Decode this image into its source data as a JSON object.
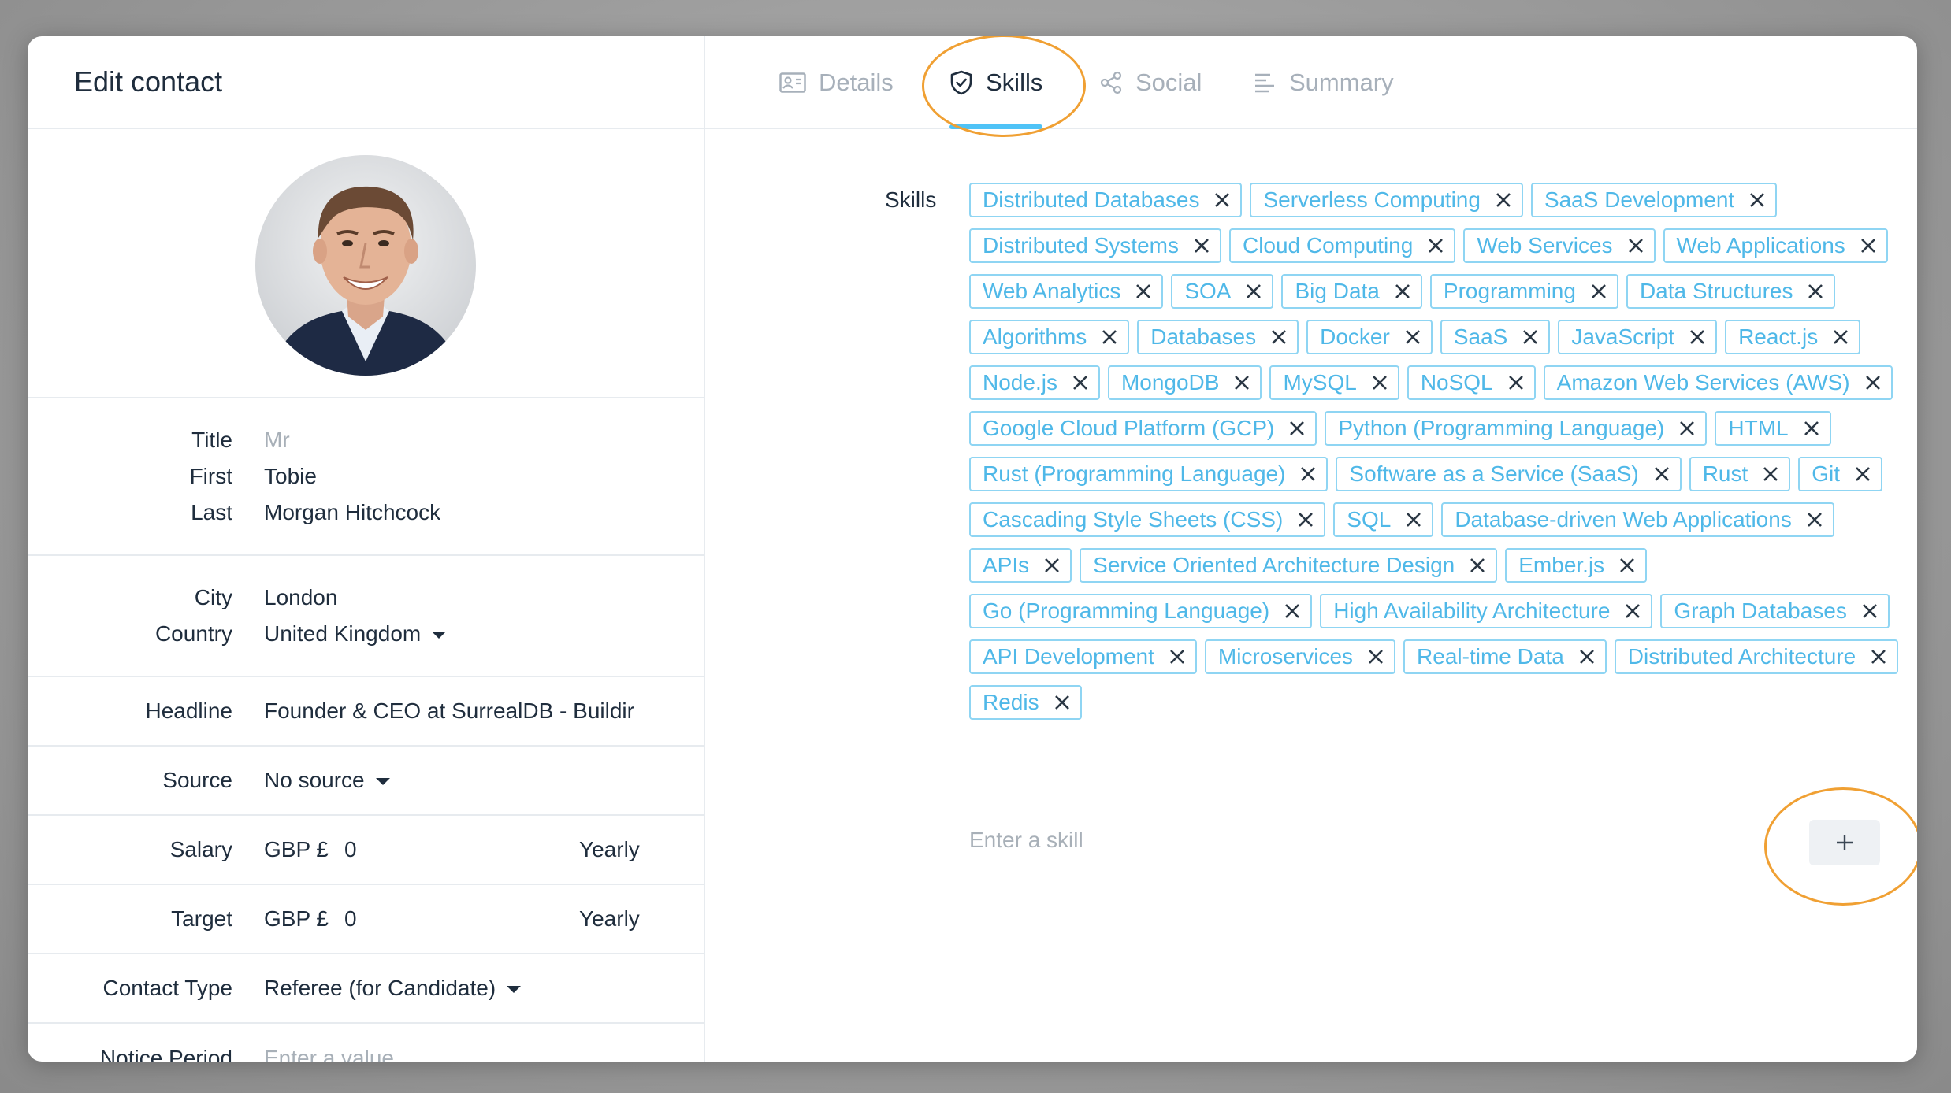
{
  "panel": {
    "title": "Edit contact"
  },
  "profile": {
    "title_label": "Title",
    "title_value": "Mr",
    "first_label": "First",
    "first_value": "Tobie",
    "last_label": "Last",
    "last_value": "Morgan Hitchcock",
    "city_label": "City",
    "city_value": "London",
    "country_label": "Country",
    "country_value": "United Kingdom",
    "headline_label": "Headline",
    "headline_value": "Founder & CEO at SurrealDB - Buildir",
    "source_label": "Source",
    "source_value": "No source",
    "salary_label": "Salary",
    "salary_currency": "GBP £",
    "salary_value": "0",
    "salary_period": "Yearly",
    "target_label": "Target",
    "target_currency": "GBP £",
    "target_value": "0",
    "target_period": "Yearly",
    "contact_type_label": "Contact Type",
    "contact_type_value": "Referee (for Candidate)",
    "notice_label": "Notice Period",
    "notice_placeholder": "Enter a value"
  },
  "tabs": [
    {
      "label": "Details",
      "icon": "id-card-icon",
      "active": false
    },
    {
      "label": "Skills",
      "icon": "shield-check-icon",
      "active": true
    },
    {
      "label": "Social",
      "icon": "share-icon",
      "active": false
    },
    {
      "label": "Summary",
      "icon": "align-left-icon",
      "active": false
    }
  ],
  "skills": {
    "label": "Skills",
    "input_placeholder": "Enter a skill",
    "add_label": "+",
    "items": [
      "Distributed Databases",
      "Serverless Computing",
      "SaaS Development",
      "Distributed Systems",
      "Cloud Computing",
      "Web Services",
      "Web Applications",
      "Web Analytics",
      "SOA",
      "Big Data",
      "Programming",
      "Data Structures",
      "Algorithms",
      "Databases",
      "Docker",
      "SaaS",
      "JavaScript",
      "React.js",
      "Node.js",
      "MongoDB",
      "MySQL",
      "NoSQL",
      "Amazon Web Services (AWS)",
      "Google Cloud Platform (GCP)",
      "Python (Programming Language)",
      "HTML",
      "Rust (Programming Language)",
      "Software as a Service (SaaS)",
      "Rust",
      "Git",
      "Cascading Style Sheets (CSS)",
      "SQL",
      "Database-driven Web Applications",
      "APIs",
      "Service Oriented Architecture Design",
      "Ember.js",
      "Go (Programming Language)",
      "High Availability Architecture",
      "Graph Databases",
      "API Development",
      "Microservices",
      "Real-time Data",
      "Distributed Architecture",
      "Redis"
    ]
  },
  "colors": {
    "accent": "#4fc3f7",
    "chip_text": "#4fb8e8",
    "chip_border": "#8fd5f3",
    "highlight_ring": "#f0a033"
  }
}
